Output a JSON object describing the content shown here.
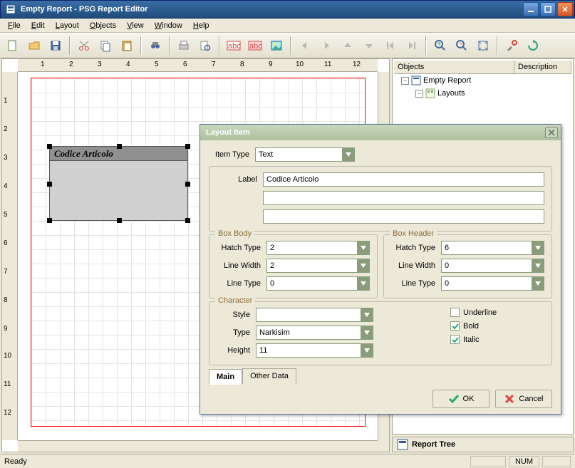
{
  "window": {
    "title": "Empty Report - PSG Report Editor"
  },
  "menu": {
    "file": "File",
    "edit": "Edit",
    "layout": "Layout",
    "objects": "Objects",
    "view": "View",
    "window": "Window",
    "help": "Help"
  },
  "ruler": {
    "h": [
      "1",
      "2",
      "3",
      "4",
      "5",
      "6",
      "7",
      "8",
      "9",
      "10",
      "11",
      "12"
    ],
    "v": [
      "1",
      "2",
      "3",
      "4",
      "5",
      "6",
      "7",
      "8",
      "9",
      "10",
      "11",
      "12"
    ]
  },
  "canvas_object": {
    "label": "Codice Articolo"
  },
  "sidebar": {
    "cols": {
      "objects": "Objects",
      "description": "Description"
    },
    "root": "Empty Report",
    "child1": "Layouts",
    "tab": "Report Tree"
  },
  "dialog": {
    "title": "Layout Item",
    "item_type_label": "Item Type",
    "item_type_value": "Text",
    "label_label": "Label",
    "label_value": "Codice Articolo",
    "box_body": {
      "legend": "Box Body",
      "hatch_type_label": "Hatch Type",
      "hatch_type_value": "2",
      "line_width_label": "Line Width",
      "line_width_value": "2",
      "line_type_label": "Line Type",
      "line_type_value": "0"
    },
    "box_header": {
      "legend": "Box Header",
      "hatch_type_label": "Hatch Type",
      "hatch_type_value": "6",
      "line_width_label": "Line Width",
      "line_width_value": "0",
      "line_type_label": "Line Type",
      "line_type_value": "0"
    },
    "character": {
      "legend": "Character",
      "style_label": "Style",
      "style_value": "",
      "type_label": "Type",
      "type_value": "Narkisim",
      "height_label": "Height",
      "height_value": "11",
      "underline": "Underline",
      "underline_checked": false,
      "bold": "Bold",
      "bold_checked": true,
      "italic": "Italic",
      "italic_checked": true
    },
    "tabs": {
      "main": "Main",
      "other": "Other Data"
    },
    "ok": "OK",
    "cancel": "Cancel"
  },
  "status": {
    "ready": "Ready",
    "num": "NUM"
  }
}
